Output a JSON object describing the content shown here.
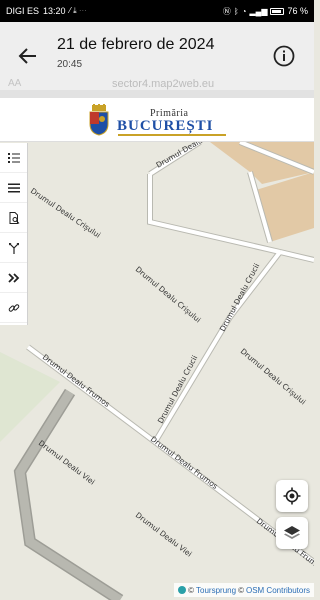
{
  "status_bar": {
    "carrier": "DIGI ES",
    "time": "13:20",
    "battery": "76 %"
  },
  "header": {
    "title": "21 de febrero de 2024",
    "subtitle": "20:45",
    "ghost_url": "sector4.map2web.eu",
    "ghost_aa": "AA"
  },
  "banner": {
    "primaria": "Primăria",
    "city": "BUCUREȘTI"
  },
  "sidebar": {
    "items": [
      {
        "name": "legend-icon"
      },
      {
        "name": "menu-icon"
      },
      {
        "name": "document-search-icon"
      },
      {
        "name": "route-icon"
      },
      {
        "name": "chevrons-right-icon"
      },
      {
        "name": "link-icon"
      }
    ]
  },
  "map": {
    "roads": [
      {
        "label": "Drumul Dealu Cri"
      },
      {
        "label": "Drumul Dealu Crișului"
      },
      {
        "label": "Drumul Dealu Crișului"
      },
      {
        "label": "Drumul Dealu Crișului"
      },
      {
        "label": "Drumul Dealu Crucii"
      },
      {
        "label": "Drumul Dealu Crucii"
      },
      {
        "label": "Drumul Dealu Frumos"
      },
      {
        "label": "Drumul Dealu Frumos"
      },
      {
        "label": "Drumul Dealu Frumos"
      },
      {
        "label": "Drumul Dealu Viei"
      },
      {
        "label": "Drumul Dealu Viei"
      }
    ]
  },
  "controls": {
    "locate": "locate-icon",
    "layers": "layers-icon"
  },
  "attribution": {
    "copyright1": "©",
    "link1": "Toursprung",
    "copyright2": "©",
    "link2": "OSM Contributors"
  },
  "colors": {
    "map_bg": "#e9e8df",
    "road": "#ffffff",
    "road_casing": "#b9b9b1",
    "building": "#e2c9a6",
    "park": "#d7e3c6",
    "accent": "#1e4fa6"
  }
}
